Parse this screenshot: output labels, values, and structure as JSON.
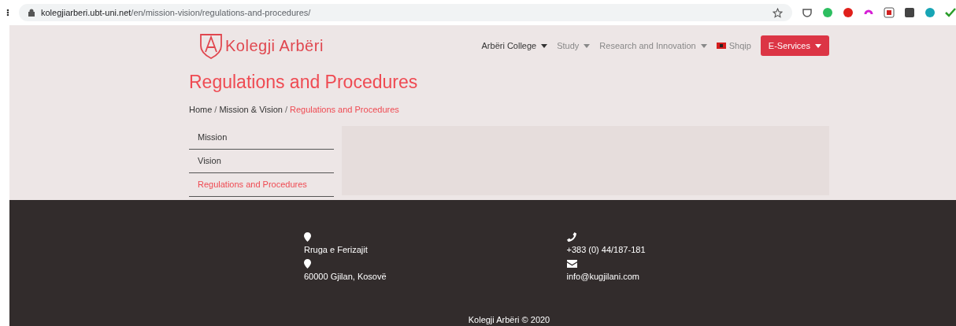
{
  "browser": {
    "url_host": "kolegjiarberi.ubt-uni.net",
    "url_path": "/en/mission-vision/regulations-and-procedures/"
  },
  "header": {
    "logo": "Kolegji Arbëri",
    "nav": [
      {
        "label": "Arbëri College",
        "selected": true,
        "dropdown": true
      },
      {
        "label": "Study",
        "selected": false,
        "dropdown": true
      },
      {
        "label": "Research and Innovation",
        "selected": false,
        "dropdown": true
      },
      {
        "label": "Shqip",
        "selected": false,
        "dropdown": false
      }
    ],
    "cta": {
      "label": "E-Services"
    }
  },
  "title": "Regulations and Procedures",
  "breadcrumb_separator": "/",
  "breadcrumb": [
    {
      "label": "Home",
      "selected": false
    },
    {
      "label": "Mission & Vision",
      "selected": false
    },
    {
      "label": "Regulations and Procedures",
      "selected": true
    }
  ],
  "sidebar": {
    "items": [
      {
        "label": "Mission",
        "selected": false
      },
      {
        "label": "Vision",
        "selected": false
      },
      {
        "label": "Regulations and Procedures",
        "selected": true
      }
    ]
  },
  "footer": {
    "columns": [
      [
        {
          "kind": "location",
          "text": "Rruga e Ferizajit"
        },
        {
          "kind": "location",
          "text": "60000 Gjilan, Kosovë"
        }
      ],
      [
        {
          "kind": "phone",
          "text": "+383 (0) 44/187-181"
        },
        {
          "kind": "email",
          "text": "info@kugjilani.com"
        }
      ]
    ],
    "copyright": "Kolegji Arbëri © 2020"
  }
}
